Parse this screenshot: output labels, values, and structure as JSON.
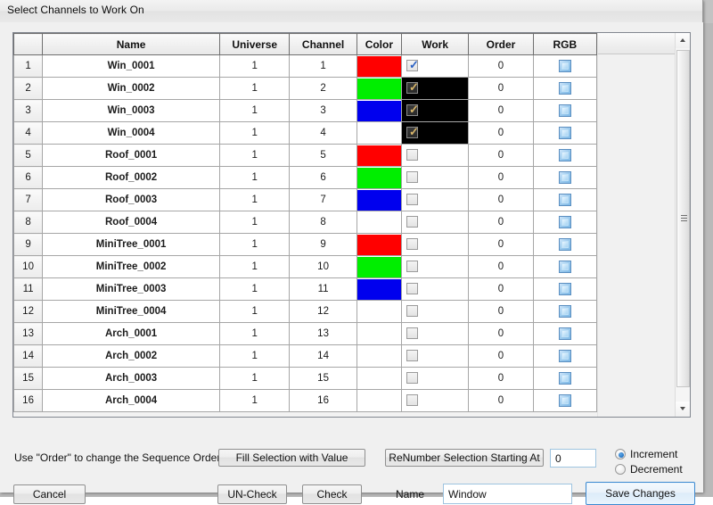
{
  "window": {
    "title": "Select Channels to Work On"
  },
  "grid": {
    "headers": [
      "",
      "Name",
      "Universe",
      "Channel",
      "Color",
      "Work",
      "Order",
      "RGB"
    ],
    "rows": [
      {
        "num": "1",
        "name": "Win_0001",
        "universe": "1",
        "channel": "1",
        "color": "#ff0000",
        "work_checked": true,
        "work_selected": false,
        "order": "0",
        "rgb": true
      },
      {
        "num": "2",
        "name": "Win_0002",
        "universe": "1",
        "channel": "2",
        "color": "#00ee00",
        "work_checked": true,
        "work_selected": true,
        "order": "0",
        "rgb": true
      },
      {
        "num": "3",
        "name": "Win_0003",
        "universe": "1",
        "channel": "3",
        "color": "#0000ee",
        "work_checked": true,
        "work_selected": true,
        "order": "0",
        "rgb": true
      },
      {
        "num": "4",
        "name": "Win_0004",
        "universe": "1",
        "channel": "4",
        "color": "#ffffff",
        "work_checked": true,
        "work_selected": true,
        "order": "0",
        "rgb": true
      },
      {
        "num": "5",
        "name": "Roof_0001",
        "universe": "1",
        "channel": "5",
        "color": "#ff0000",
        "work_checked": false,
        "work_selected": false,
        "order": "0",
        "rgb": true
      },
      {
        "num": "6",
        "name": "Roof_0002",
        "universe": "1",
        "channel": "6",
        "color": "#00ee00",
        "work_checked": false,
        "work_selected": false,
        "order": "0",
        "rgb": true
      },
      {
        "num": "7",
        "name": "Roof_0003",
        "universe": "1",
        "channel": "7",
        "color": "#0000ee",
        "work_checked": false,
        "work_selected": false,
        "order": "0",
        "rgb": true
      },
      {
        "num": "8",
        "name": "Roof_0004",
        "universe": "1",
        "channel": "8",
        "color": "#ffffff",
        "work_checked": false,
        "work_selected": false,
        "order": "0",
        "rgb": true
      },
      {
        "num": "9",
        "name": "MiniTree_0001",
        "universe": "1",
        "channel": "9",
        "color": "#ff0000",
        "work_checked": false,
        "work_selected": false,
        "order": "0",
        "rgb": true
      },
      {
        "num": "10",
        "name": "MiniTree_0002",
        "universe": "1",
        "channel": "10",
        "color": "#00ee00",
        "work_checked": false,
        "work_selected": false,
        "order": "0",
        "rgb": true
      },
      {
        "num": "11",
        "name": "MiniTree_0003",
        "universe": "1",
        "channel": "11",
        "color": "#0000ee",
        "work_checked": false,
        "work_selected": false,
        "order": "0",
        "rgb": true
      },
      {
        "num": "12",
        "name": "MiniTree_0004",
        "universe": "1",
        "channel": "12",
        "color": "#ffffff",
        "work_checked": false,
        "work_selected": false,
        "order": "0",
        "rgb": true
      },
      {
        "num": "13",
        "name": "Arch_0001",
        "universe": "1",
        "channel": "13",
        "color": "#ffffff",
        "work_checked": false,
        "work_selected": false,
        "order": "0",
        "rgb": true
      },
      {
        "num": "14",
        "name": "Arch_0002",
        "universe": "1",
        "channel": "14",
        "color": "#ffffff",
        "work_checked": false,
        "work_selected": false,
        "order": "0",
        "rgb": true
      },
      {
        "num": "15",
        "name": "Arch_0003",
        "universe": "1",
        "channel": "15",
        "color": "#ffffff",
        "work_checked": false,
        "work_selected": false,
        "order": "0",
        "rgb": true
      },
      {
        "num": "16",
        "name": "Arch_0004",
        "universe": "1",
        "channel": "16",
        "color": "#ffffff",
        "work_checked": false,
        "work_selected": false,
        "order": "0",
        "rgb": true
      }
    ]
  },
  "footer": {
    "hint": "Use \"Order\" to change the Sequence Order",
    "fill_selection_label": "Fill Selection with Value",
    "renumber_label": "ReNumber Selection Starting At",
    "renumber_value": "0",
    "increment_label": "Increment",
    "decrement_label": "Decrement",
    "increment_selected": true,
    "cancel_label": "Cancel",
    "uncheck_label": "UN-Check",
    "check_label": "Check",
    "name_label": "Name",
    "name_value": "Window",
    "save_label": "Save Changes"
  },
  "scrollbar": {
    "up_icon": "arrow-up-icon",
    "down_icon": "arrow-down-icon"
  }
}
